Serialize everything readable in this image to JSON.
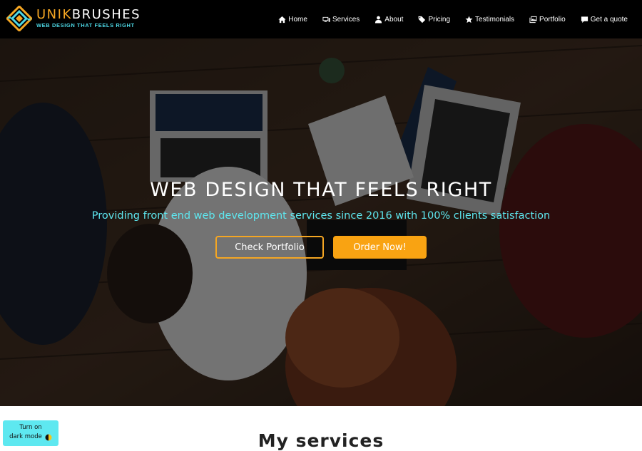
{
  "brand": {
    "name_part1": "UNIK",
    "name_part2": "BRUSHES",
    "tagline": "WEB DESIGN THAT FEELS RIGHT",
    "accent_color": "#f5a623",
    "secondary_color": "#4dd8e6"
  },
  "nav": {
    "items": [
      {
        "label": "Home",
        "icon": "home-icon"
      },
      {
        "label": "Services",
        "icon": "monitor-icon"
      },
      {
        "label": "About",
        "icon": "user-icon"
      },
      {
        "label": "Pricing",
        "icon": "tag-icon"
      },
      {
        "label": "Testimonials",
        "icon": "star-icon"
      },
      {
        "label": "Portfolio",
        "icon": "images-icon"
      },
      {
        "label": "Get a quote",
        "icon": "comment-icon"
      }
    ]
  },
  "hero": {
    "title": "WEB DESIGN THAT FEELS RIGHT",
    "subtitle": "Providing front end web development services since 2016 with 100% clients satisfaction",
    "primary_button": "Check Portfolio",
    "secondary_button": "Order Now!",
    "subtitle_color": "#5ee8f0",
    "button_color": "#f9a312"
  },
  "dark_mode_toggle": {
    "line1": "Turn on",
    "line2": "dark mode",
    "icon": "half-moon-icon"
  },
  "services_section": {
    "title": "My services"
  }
}
